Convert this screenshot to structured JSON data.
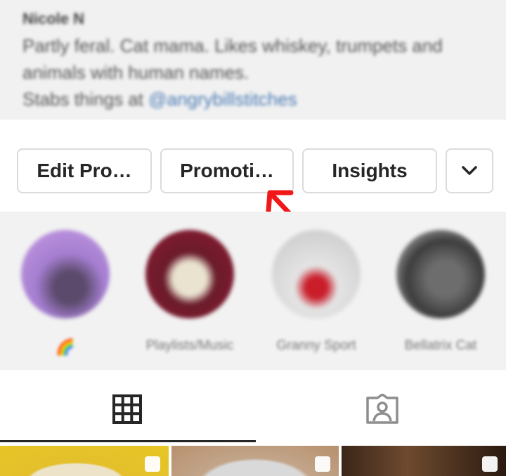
{
  "profile": {
    "name": "Nicole N",
    "bio_lines": [
      "Partly feral. Cat mama. Likes whiskey, trumpets and",
      "animals with human names."
    ],
    "bio_last_prefix": "Stabs things at ",
    "bio_link": "@angrybillstitches"
  },
  "actions": {
    "edit_profile": "Edit Pro…",
    "promotions": "Promoti…",
    "insights": "Insights",
    "more_icon": "chevron-down-icon"
  },
  "highlights": [
    {
      "label": "🌈"
    },
    {
      "label": "Playlists/Music"
    },
    {
      "label": "Granny Sport"
    },
    {
      "label": "Bellatrix Cat"
    }
  ],
  "tabs": {
    "grid_icon": "grid-icon",
    "tagged_icon": "tagged-person-icon",
    "active": "grid"
  },
  "annotation": {
    "color": "#f01818"
  },
  "colors": {
    "text": "#262626",
    "border": "#dbdbdb",
    "link": "#4a7bb5"
  }
}
